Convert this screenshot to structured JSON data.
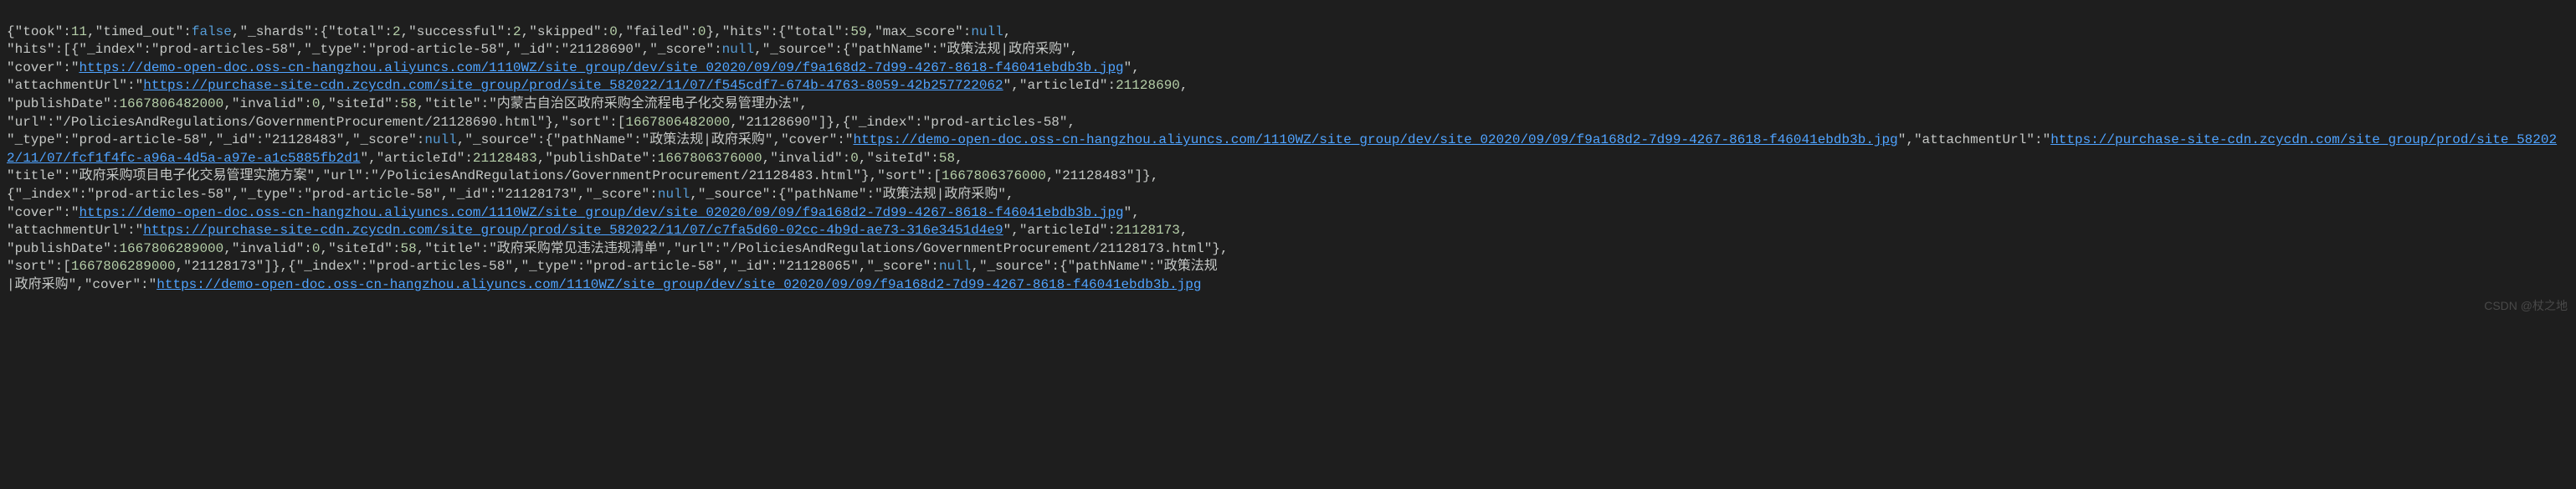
{
  "watermark": "CSDN @杖之地",
  "json": {
    "took": 11,
    "timed_out": false,
    "_shards": {
      "total": 2,
      "successful": 2,
      "skipped": 0,
      "failed": 0
    },
    "hits": {
      "total": 59,
      "max_score": null,
      "hits": [
        {
          "_index": "prod-articles-58",
          "_type": "prod-article-58",
          "_id": "21128690",
          "_score": null,
          "_source": {
            "pathName": "政策法规|政府采购",
            "cover": "https://demo-open-doc.oss-cn-hangzhou.aliyuncs.com/1110WZ/site_group/dev/site_02020/09/09/f9a168d2-7d99-4267-8618-f46041ebdb3b.jpg",
            "attachmentUrl": "https://purchase-site-cdn.zcycdn.com/site_group/prod/site_582022/11/07/f545cdf7-674b-4763-8059-42b257722062",
            "articleId": 21128690,
            "publishDate": 1667806482000,
            "invalid": 0,
            "siteId": 58,
            "title": "内蒙古自治区政府采购全流程电子化交易管理办法",
            "url": "/PoliciesAndRegulations/GovernmentProcurement/21128690.html"
          },
          "sort": [
            1667806482000,
            "21128690"
          ]
        },
        {
          "_index": "prod-articles-58",
          "_type": "prod-article-58",
          "_id": "21128483",
          "_score": null,
          "_source": {
            "pathName": "政策法规|政府采购",
            "cover": "https://demo-open-doc.oss-cn-hangzhou.aliyuncs.com/1110WZ/site_group/dev/site_02020/09/09/f9a168d2-7d99-4267-8618-f46041ebdb3b.jpg",
            "attachmentUrl": "https://purchase-site-cdn.zcycdn.com/site_group/prod/site_582022/11/07/fcf1f4fc-a96a-4d5a-a97e-a1c5885fb2d1",
            "articleId": 21128483,
            "publishDate": 1667806376000,
            "invalid": 0,
            "siteId": 58,
            "title": "政府采购项目电子化交易管理实施方案",
            "url": "/PoliciesAndRegulations/GovernmentProcurement/21128483.html"
          },
          "sort": [
            1667806376000,
            "21128483"
          ]
        },
        {
          "_index": "prod-articles-58",
          "_type": "prod-article-58",
          "_id": "21128173",
          "_score": null,
          "_source": {
            "pathName": "政策法规|政府采购",
            "cover": "https://demo-open-doc.oss-cn-hangzhou.aliyuncs.com/1110WZ/site_group/dev/site_02020/09/09/f9a168d2-7d99-4267-8618-f46041ebdb3b.jpg",
            "attachmentUrl": "https://purchase-site-cdn.zcycdn.com/site_group/prod/site_582022/11/07/c7fa5d60-02cc-4b9d-ae73-316e3451d4e9",
            "articleId": 21128173,
            "publishDate": 1667806289000,
            "invalid": 0,
            "siteId": 58,
            "title": "政府采购常见违法违规清单",
            "url": "/PoliciesAndRegulations/GovernmentProcurement/21128173.html"
          },
          "sort": [
            1667806289000,
            "21128173"
          ]
        },
        {
          "_index": "prod-articles-58",
          "_type": "prod-article-58",
          "_id": "21128065",
          "_score": null,
          "_source": {
            "pathName": "政策法规|政府采购",
            "cover_trunc": "https://demo-open-doc.oss-cn-hangzhou.aliyuncs.com/1110WZ/site_group/dev/site_02020/09/09/f9a168d2-7d99-4267-8618-f46041ebdb3b.jpg"
          }
        }
      ]
    }
  }
}
